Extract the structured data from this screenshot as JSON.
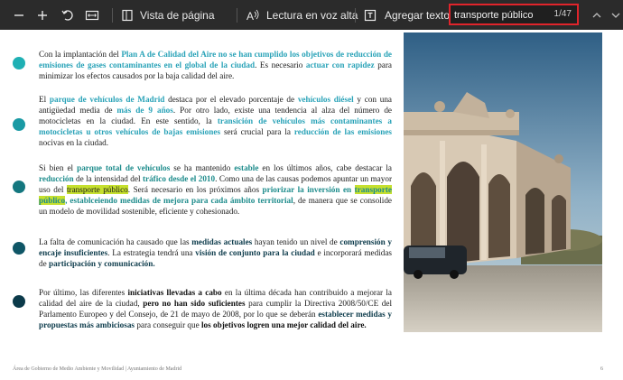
{
  "toolbar": {
    "page_view_label": "Vista de página",
    "read_aloud_label": "Lectura en voz alta",
    "add_text_label": "Agregar texto",
    "search_value": "transporte público",
    "search_count": "1/47"
  },
  "paragraphs": [
    {
      "segments": [
        {
          "t": "Con la implantación del ",
          "s": "n"
        },
        {
          "t": "Plan A de Calidad del Aire no se han cumplido los objetivos de reducción de emisiones de gases contaminantes en el global de la ciudad",
          "s": "h"
        },
        {
          "t": ". Es necesario ",
          "s": "n"
        },
        {
          "t": "actuar con rapidez",
          "s": "h"
        },
        {
          "t": " para minimizar los efectos causados por la baja calidad del aire.",
          "s": "n"
        }
      ]
    },
    {
      "segments": [
        {
          "t": "El ",
          "s": "n"
        },
        {
          "t": "parque de vehículos de Madrid",
          "s": "h"
        },
        {
          "t": " destaca por el elevado porcentaje de ",
          "s": "n"
        },
        {
          "t": "vehículos diésel",
          "s": "h"
        },
        {
          "t": " y con una antigüedad media de ",
          "s": "n"
        },
        {
          "t": "más de 9 años",
          "s": "h"
        },
        {
          "t": ". Por otro lado, existe una tendencia al alza del número de motocicletas en la ciudad. En este sentido, la ",
          "s": "n"
        },
        {
          "t": "transición de vehículos más contaminantes a motocicletas u otros vehículos de bajas emisiones",
          "s": "h"
        },
        {
          "t": " será crucial para la ",
          "s": "n"
        },
        {
          "t": "reducción de las emisiones",
          "s": "h"
        },
        {
          "t": " nocivas en la ciudad.",
          "s": "n"
        }
      ]
    },
    {
      "segments": [
        {
          "t": "Si bien el ",
          "s": "n"
        },
        {
          "t": "parque total de vehículos",
          "s": "g"
        },
        {
          "t": " se ha mantenido ",
          "s": "n"
        },
        {
          "t": "estable",
          "s": "g"
        },
        {
          "t": " en los últimos años, cabe destacar la ",
          "s": "n"
        },
        {
          "t": "reducción",
          "s": "g"
        },
        {
          "t": " de la intensidad del ",
          "s": "n"
        },
        {
          "t": "tráfico desde el 2010",
          "s": "g"
        },
        {
          "t": ". Como una de las causas podemos apuntar un mayor uso del ",
          "s": "n"
        },
        {
          "t": "transporte público",
          "s": "m"
        },
        {
          "t": ". Será necesario en los próximos años ",
          "s": "n"
        },
        {
          "t": "priorizar la inversión en ",
          "s": "g"
        },
        {
          "t": "transporte público",
          "s": "gm"
        },
        {
          "t": ", establceiendo medidas de mejora para cada ámbito territorial",
          "s": "g"
        },
        {
          "t": ", de manera que se consolide un modelo de movilidad sostenible, eficiente y cohesionado.",
          "s": "n"
        }
      ]
    },
    {
      "segments": [
        {
          "t": "La falta de comunicación ha causado que las ",
          "s": "n"
        },
        {
          "t": "medidas actuales",
          "s": "d"
        },
        {
          "t": " hayan tenido un nivel de ",
          "s": "n"
        },
        {
          "t": "comprensión y encaje insuficientes",
          "s": "d"
        },
        {
          "t": ". La estrategia tendrá una ",
          "s": "n"
        },
        {
          "t": "visión de conjunto para la ciudad",
          "s": "d"
        },
        {
          "t": " e incorporará medidas de ",
          "s": "n"
        },
        {
          "t": "participación y comunicación.",
          "s": "d"
        }
      ]
    },
    {
      "segments": [
        {
          "t": "Por último, las diferentes ",
          "s": "n"
        },
        {
          "t": "iniciativas llevadas a cabo",
          "s": "b"
        },
        {
          "t": " en la última década han contribuido a mejorar la calidad del aire de la ciudad, ",
          "s": "n"
        },
        {
          "t": "pero no han sido suficientes",
          "s": "b"
        },
        {
          "t": " para cumplir la Directiva 2008/50/CE del Parlamento Europeo y del Consejo, de 21 de mayo de 2008, por lo que se deberán ",
          "s": "n"
        },
        {
          "t": "establecer medidas y propuestas más ambiciosas",
          "s": "d"
        },
        {
          "t": " para conseguir que ",
          "s": "n"
        },
        {
          "t": "los objetivos logren una mejor calidad del aire.",
          "s": "b"
        }
      ]
    }
  ],
  "bullet_colors": [
    "#1fb0b4",
    "#1a9aa4",
    "#14777f",
    "#0f5666",
    "#0b3a4a"
  ],
  "footer": {
    "left": "Área de Gobierno de Medio Ambiente y Movilidad  |  Ayuntamiento de Madrid",
    "page_number": "6"
  },
  "colors": {
    "toolbar_bg": "#2b2b2b",
    "search_border": "#e0242b",
    "teal": "#2aa3b8",
    "highlight": "#c6e02e"
  }
}
